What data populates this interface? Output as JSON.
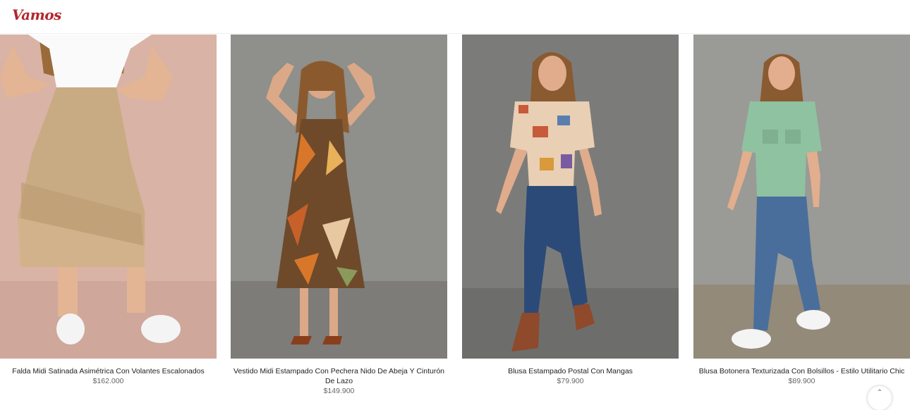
{
  "brand": {
    "logo_text": "Vamos",
    "color": "#b3262d"
  },
  "products": [
    {
      "name": "Falda Midi Satinada Asimétrica Con Volantes Escalonados",
      "price": "$162.000"
    },
    {
      "name": "Vestido Midi Estampado Con Pechera Nido De Abeja Y Cinturón De Lazo",
      "price": "$149.900"
    },
    {
      "name": "Blusa Estampado Postal Con Mangas",
      "price": "$79.900"
    },
    {
      "name": "Blusa Botonera Texturizada Con Bolsillos - Estilo Utilitario Chic",
      "price": "$89.900"
    }
  ],
  "scroll_top_icon": "chevron-up-icon"
}
